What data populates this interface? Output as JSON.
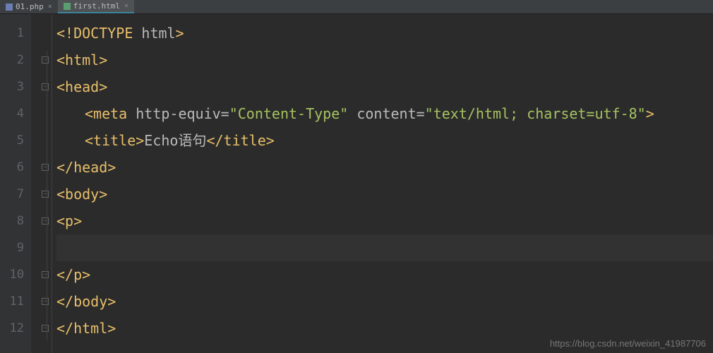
{
  "tabs": [
    {
      "label": "01.php",
      "active": false
    },
    {
      "label": "first.html",
      "active": true
    }
  ],
  "lines": [
    "1",
    "2",
    "3",
    "4",
    "5",
    "6",
    "7",
    "8",
    "9",
    "10",
    "11",
    "12"
  ],
  "code": {
    "l1": {
      "open": "<!",
      "doctype": "DOCTYPE ",
      "html": "html",
      "close": ">"
    },
    "l2": {
      "open": "<html>",
      "close": ""
    },
    "l3": {
      "t": "<head>"
    },
    "l4": {
      "open": "<meta ",
      "attr1": "http-equiv=",
      "val1": "\"Content-Type\"",
      "space1": " ",
      "attr2": "content=",
      "val2": "\"text/html; charset=utf-8\"",
      "close": ">"
    },
    "l5": {
      "open": "<title>",
      "text": "Echo语句",
      "close": "</title>"
    },
    "l6": {
      "t": "</head>"
    },
    "l7": {
      "t": "<body>"
    },
    "l8": {
      "t": "<p>"
    },
    "l9": {
      "t": ""
    },
    "l10": {
      "t": "</p>"
    },
    "l11": {
      "t": "</body>"
    },
    "l12": {
      "t": "</html>"
    }
  },
  "watermark": "https://blog.csdn.net/weixin_41987706"
}
